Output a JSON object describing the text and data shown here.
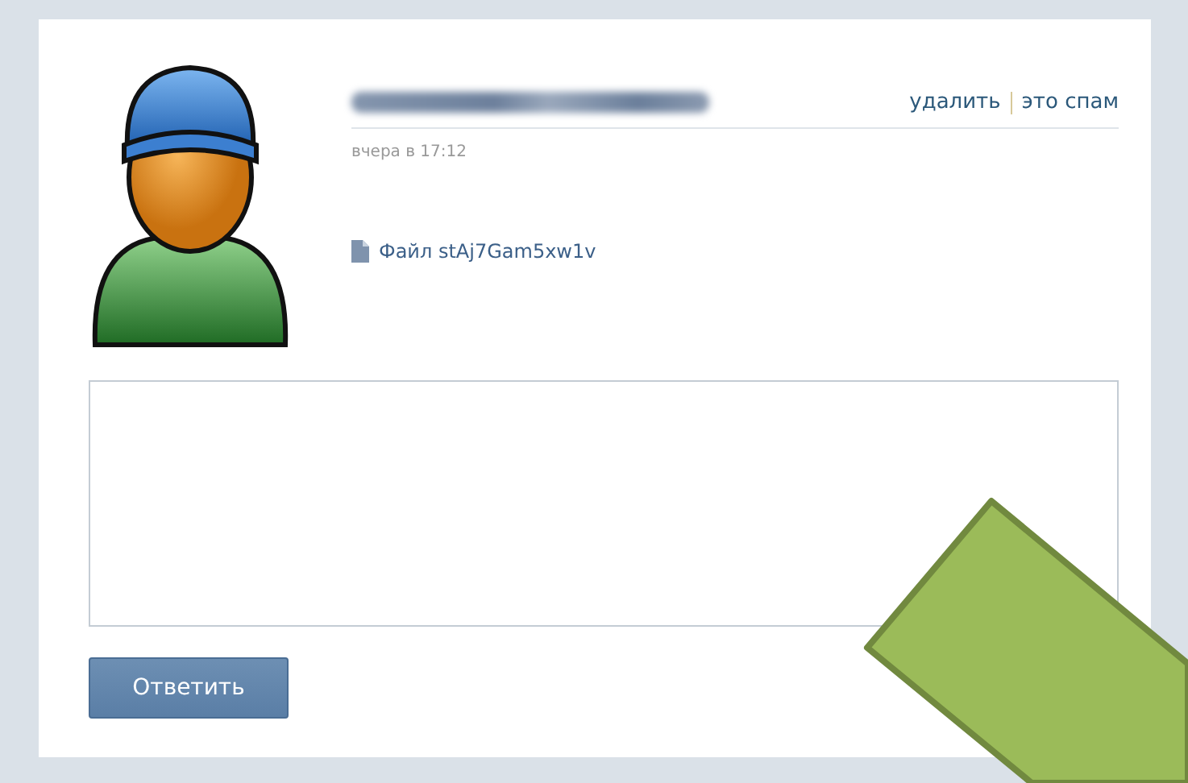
{
  "message": {
    "date": "вчера в 17:12",
    "actions": [
      {
        "label": "удалить"
      },
      {
        "label": "это спам"
      }
    ],
    "attachment": {
      "label": "Файл stAj7Gam5xw1v"
    }
  },
  "reply_button": {
    "label": "Ответить"
  }
}
